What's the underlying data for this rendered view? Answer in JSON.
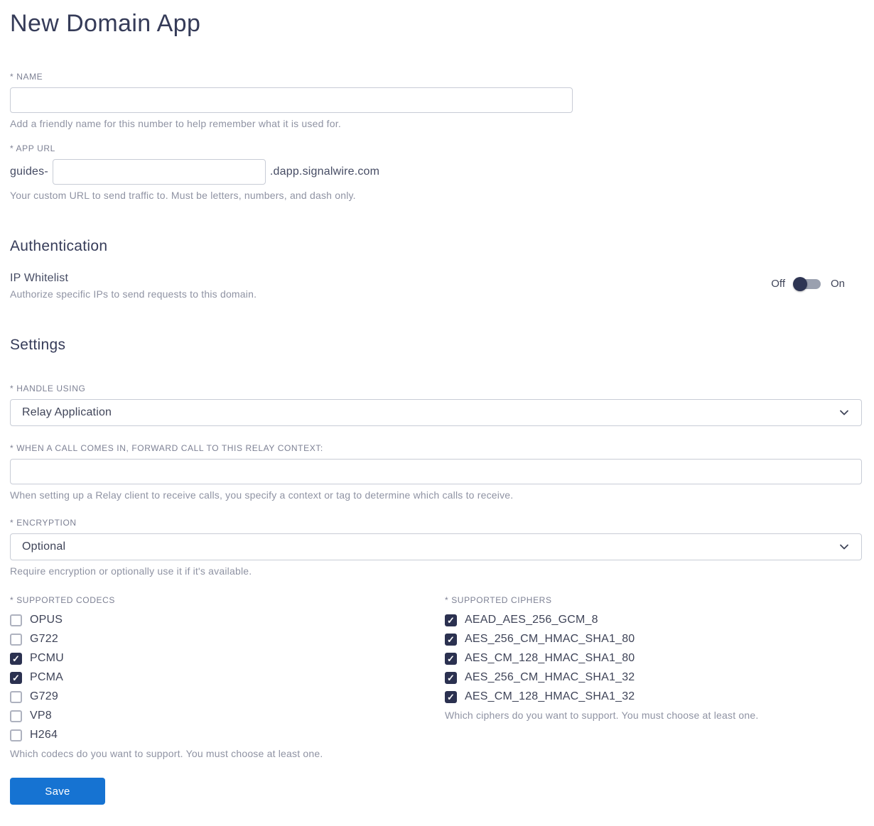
{
  "page": {
    "title": "New Domain App"
  },
  "form": {
    "name": {
      "label": "* NAME",
      "value": "",
      "helper": "Add a friendly name for this number to help remember what it is used for."
    },
    "app_url": {
      "label": "* APP URL",
      "prefix": "guides-",
      "value": "",
      "suffix": ".dapp.signalwire.com",
      "helper": "Your custom URL to send traffic to. Must be letters, numbers, and dash only."
    }
  },
  "authentication": {
    "heading": "Authentication",
    "ip_whitelist": {
      "label": "IP Whitelist",
      "helper": "Authorize specific IPs to send requests to this domain.",
      "off_label": "Off",
      "on_label": "On",
      "state": "off"
    }
  },
  "settings": {
    "heading": "Settings",
    "handle_using": {
      "label": "* HANDLE USING",
      "value": "Relay Application"
    },
    "relay_context": {
      "label": "* WHEN A CALL COMES IN, FORWARD CALL TO THIS RELAY CONTEXT:",
      "value": "",
      "helper": "When setting up a Relay client to receive calls, you specify a context or tag to determine which calls to receive."
    },
    "encryption": {
      "label": "* ENCRYPTION",
      "value": "Optional",
      "helper": "Require encryption or optionally use it if it's available."
    },
    "codecs": {
      "label": "* SUPPORTED CODECS",
      "helper": "Which codecs do you want to support. You must choose at least one.",
      "items": [
        {
          "label": "OPUS",
          "checked": false
        },
        {
          "label": "G722",
          "checked": false
        },
        {
          "label": "PCMU",
          "checked": true
        },
        {
          "label": "PCMA",
          "checked": true
        },
        {
          "label": "G729",
          "checked": false
        },
        {
          "label": "VP8",
          "checked": false
        },
        {
          "label": "H264",
          "checked": false
        }
      ]
    },
    "ciphers": {
      "label": "* SUPPORTED CIPHERS",
      "helper": "Which ciphers do you want to support. You must choose at least one.",
      "items": [
        {
          "label": "AEAD_AES_256_GCM_8",
          "checked": true
        },
        {
          "label": "AES_256_CM_HMAC_SHA1_80",
          "checked": true
        },
        {
          "label": "AES_CM_128_HMAC_SHA1_80",
          "checked": true
        },
        {
          "label": "AES_256_CM_HMAC_SHA1_32",
          "checked": true
        },
        {
          "label": "AES_CM_128_HMAC_SHA1_32",
          "checked": true
        }
      ]
    }
  },
  "save_button": {
    "label": "Save"
  },
  "colors": {
    "primary_button": "#1673d2",
    "checkbox_checked": "#2b3150",
    "heading_text": "#353b58",
    "toggle_knob": "#2e3553",
    "toggle_track": "#9aa0af"
  }
}
